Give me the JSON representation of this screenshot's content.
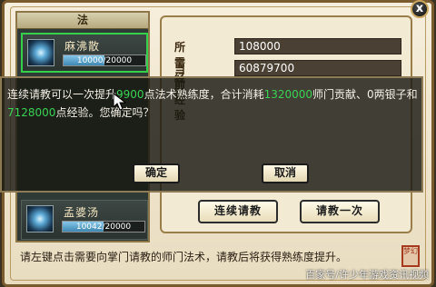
{
  "window": {
    "close_label": "x"
  },
  "left_panel": {
    "header_label": "法",
    "skills": [
      {
        "name": "麻沸散",
        "progress_text": "10000/20000",
        "progress": 0.5,
        "icon": "skill-icon-mafeisan",
        "selected": true
      },
      {
        "name": "孟婆汤",
        "progress_text": "10042/20000",
        "progress": 0.5021,
        "icon": "skill-icon-mengpotang",
        "selected": false
      }
    ]
  },
  "info": {
    "required_exp_label": "所需经验",
    "required_exp_value": "108000",
    "current_exp_label": "当前经验",
    "current_exp_value": "60879700"
  },
  "buttons": {
    "continue_learn": "连续请教",
    "learn_once": "请教一次"
  },
  "hint": "请左键点击需要向掌门请教的师门法术，请教后将获得熟练度提升。",
  "seal_text": "梦幻",
  "watermark": "百家号/许少年游戏资讯视频",
  "dialog": {
    "text_1": "连续请教可以一次提升",
    "num_1": "9900",
    "text_2": "点法术熟练度，合计消耗",
    "num_2": "1320000",
    "text_3": "师门贡献、0两银子和",
    "num_3": "7128000",
    "text_4": "点经验。您确定吗？",
    "confirm_label": "确定",
    "cancel_label": "取消"
  },
  "colors": {
    "highlight_number": "#39d353",
    "selected_border": "#36d14a",
    "parchment": "#f3ead4"
  }
}
